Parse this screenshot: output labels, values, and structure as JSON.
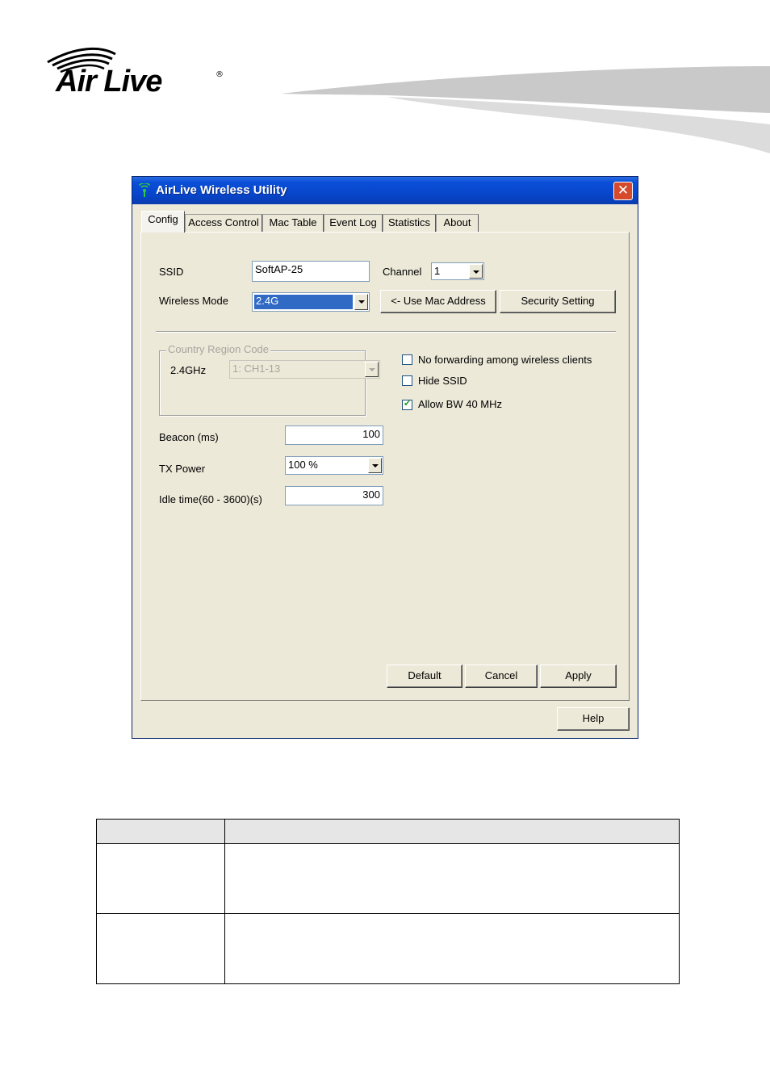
{
  "brand": {
    "logo_text": "Air Live"
  },
  "window": {
    "title": "AirLive Wireless Utility",
    "close_glyph": "✕"
  },
  "tabs": [
    {
      "label": "Config"
    },
    {
      "label": "Access Control"
    },
    {
      "label": "Mac Table"
    },
    {
      "label": "Event Log"
    },
    {
      "label": "Statistics"
    },
    {
      "label": "About"
    }
  ],
  "config": {
    "ssid_label": "SSID",
    "ssid_value": "SoftAP-25",
    "channel_label": "Channel",
    "channel_value": "1",
    "wireless_mode_label": "Wireless Mode",
    "wireless_mode_value": "2.4G",
    "use_mac_button": "<- Use Mac Address",
    "security_button": "Security Setting",
    "country_group_title": "Country Region Code",
    "band_label": "2.4GHz",
    "region_value": "1: CH1-13",
    "no_forwarding_label": "No forwarding among wireless clients",
    "no_forwarding_checked": false,
    "hide_ssid_label": "Hide SSID",
    "hide_ssid_checked": false,
    "allow_bw_label": "Allow BW 40 MHz",
    "allow_bw_checked": true,
    "beacon_label": "Beacon (ms)",
    "beacon_value": "100",
    "tx_power_label": "TX Power",
    "tx_power_value": "100 %",
    "idle_label": "Idle time(60 - 3600)(s)",
    "idle_value": "300",
    "default_button": "Default",
    "cancel_button": "Cancel",
    "apply_button": "Apply",
    "help_button": "Help"
  },
  "colors": {
    "titlebar": "#0a4fd8",
    "dialog_bg": "#ece9d8",
    "selection": "#316ac5",
    "close": "#d6492c"
  }
}
